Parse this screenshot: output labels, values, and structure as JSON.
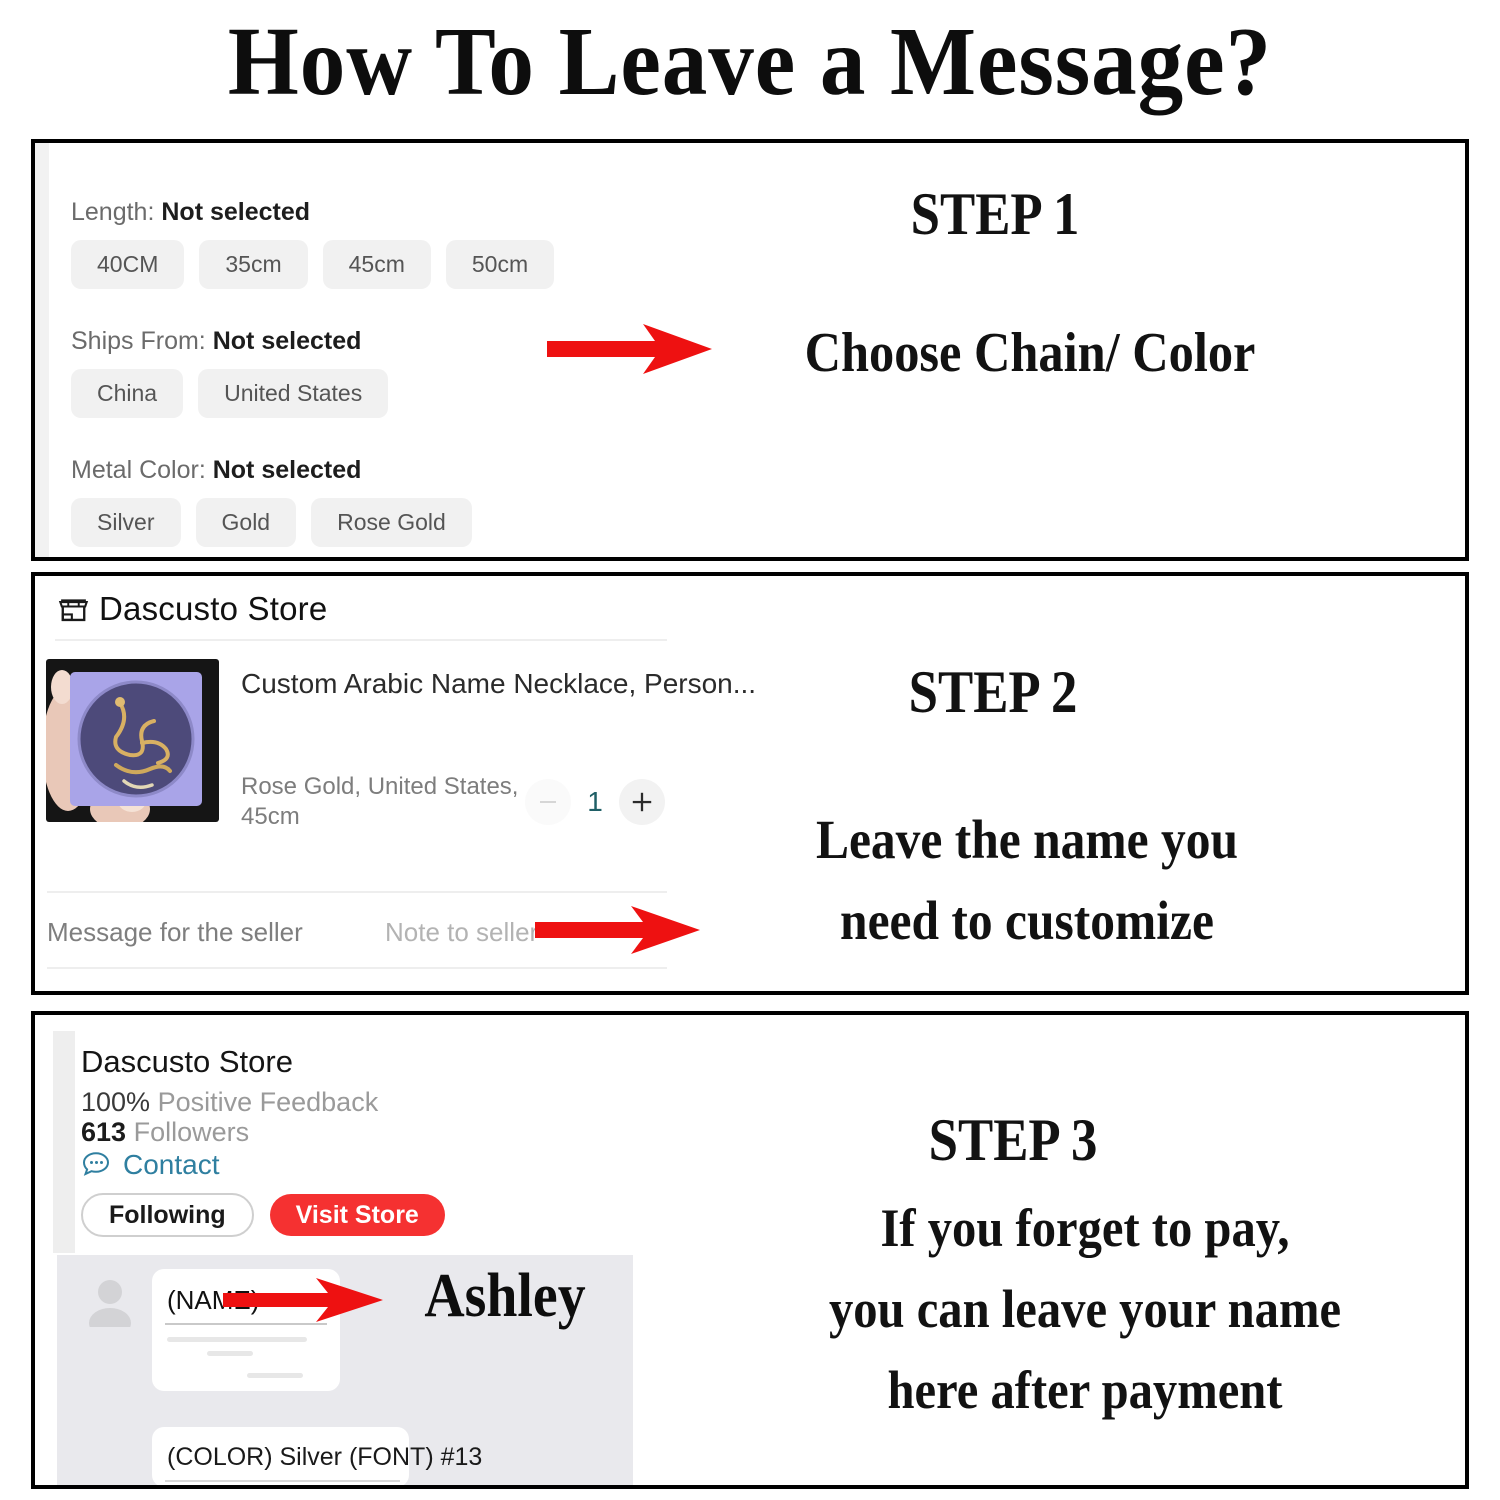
{
  "title": "How To Leave a Message?",
  "colors": {
    "arrow_red": "#EE1111",
    "visit_store_red": "#F53131",
    "contact_link": "#2F7FA0",
    "qty_value": "#1F5F66",
    "chip_bg": "#F1F1F1",
    "chat_bg": "#E9E9ED"
  },
  "step1": {
    "label": "STEP 1",
    "callout": "Choose Chain/ Color",
    "arrow_icon": "red-right-arrow-icon",
    "options": [
      {
        "label": "Length:",
        "value": "Not selected",
        "choices": [
          "40CM",
          "35cm",
          "45cm",
          "50cm"
        ]
      },
      {
        "label": "Ships From:",
        "value": "Not selected",
        "choices": [
          "China",
          "United States"
        ]
      },
      {
        "label": "Metal Color:",
        "value": "Not selected",
        "choices": [
          "Silver",
          "Gold",
          "Rose Gold"
        ]
      }
    ]
  },
  "step2": {
    "label": "STEP 2",
    "callout_line1": "Leave the name you",
    "callout_line2": "need to customize",
    "arrow_icon": "red-right-arrow-icon",
    "cart": {
      "store_icon": "storefront-icon",
      "store_name": "Dascusto Store",
      "product_image": "necklace-in-box-photo",
      "product_title": "Custom Arabic Name Necklace, Person...",
      "product_variant_line1": "Rose Gold, United States,",
      "product_variant_line2": "45cm",
      "qty_decrease_icon": "minus-icon",
      "qty_value": "1",
      "qty_increase_icon": "plus-icon",
      "message_label": "Message for the seller",
      "message_placeholder": "Note to seller"
    }
  },
  "step3": {
    "label": "STEP 3",
    "callout_line1": "If you forget to pay,",
    "callout_line2": "you can leave your name",
    "callout_line3": "here after payment",
    "arrow_icon": "red-right-arrow-icon",
    "answer": "Ashley",
    "seller": {
      "name": "Dascusto Store",
      "feedback_percent": "100%",
      "feedback_label": "Positive Feedback",
      "followers_count": "613",
      "followers_label": "Followers",
      "contact_icon": "chat-bubble-icon",
      "contact_label": "Contact",
      "following_button": "Following",
      "visit_store_button": "Visit Store"
    },
    "chat": {
      "avatar_icon": "user-avatar-icon",
      "bubble1_text": "(NAME)",
      "bubble2_text": "(COLOR) Silver   (FONT) #13"
    }
  }
}
